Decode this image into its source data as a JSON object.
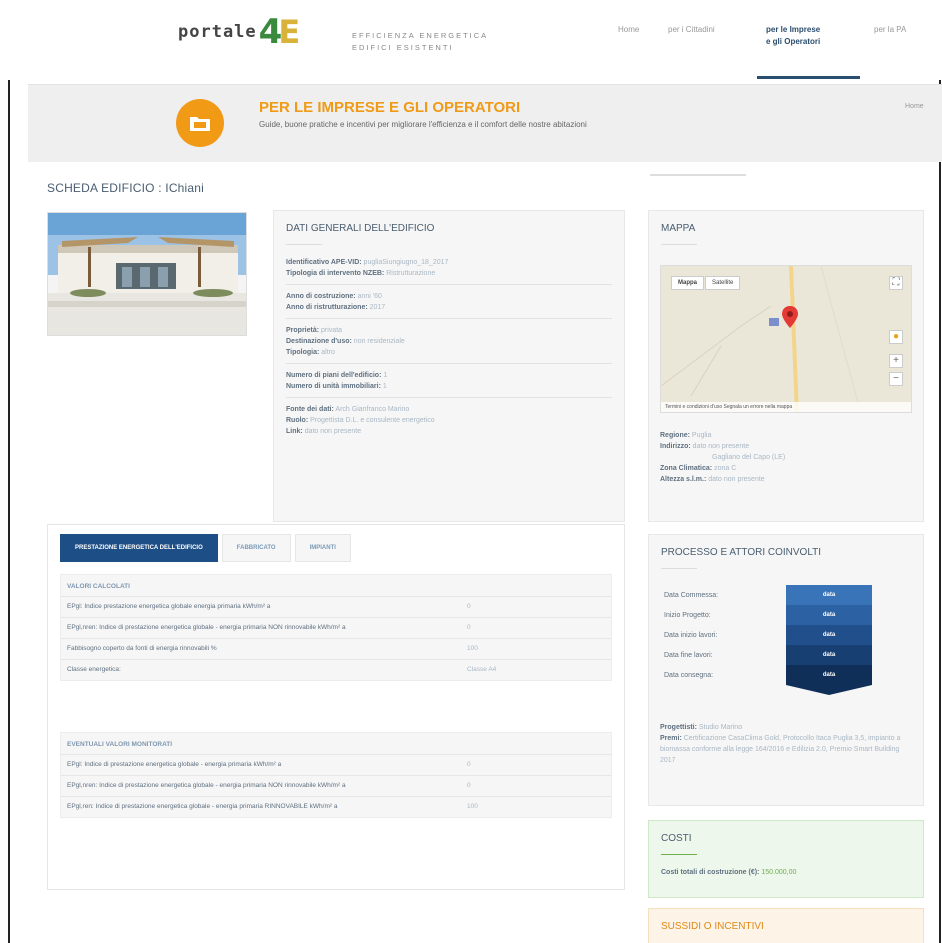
{
  "header": {
    "logo_word": "portale",
    "logo_number": "4",
    "logo_letter": "E",
    "tagline_line1": "EFFICIENZA ENERGETICA",
    "tagline_line2": "EDIFICI ESISTENTI",
    "nav": [
      {
        "label": "Home"
      },
      {
        "label": "per i Cittadini"
      },
      {
        "label_line1": "per le Imprese",
        "label_line2": "e gli Operatori"
      },
      {
        "label": "per la PA"
      }
    ]
  },
  "banner": {
    "title": "PER LE IMPRESE E GLI OPERATORI",
    "subtitle": "Guide, buone pratiche e incentivi per migliorare l'efficienza e il comfort delle nostre abitazioni",
    "right_text": "Home",
    "icon": "folder-icon",
    "accent_color": "#f09a16"
  },
  "page_title": "SCHEDA EDIFICIO : IChiani",
  "general": {
    "title": "DATI GENERALI DELL'EDIFICIO",
    "groups": [
      [
        {
          "label": "Identificativo APE-VID:",
          "value": "pugliaSiungiugno_18_2017"
        },
        {
          "label": "Tipologia di intervento NZEB:",
          "value": "Ristrutturazione"
        }
      ],
      [
        {
          "label": "Anno di costruzione:",
          "value": "anni '60"
        },
        {
          "label": "Anno di ristrutturazione:",
          "value": "2017"
        }
      ],
      [
        {
          "label": "Proprietà:",
          "value": "privata"
        },
        {
          "label": "Destinazione d'uso:",
          "value": "non residenziale"
        },
        {
          "label": "Tipologia:",
          "value": "altro"
        }
      ],
      [
        {
          "label": "Numero di piani dell'edificio:",
          "value": "1"
        },
        {
          "label": "Numero di unità immobiliari:",
          "value": "1"
        }
      ],
      [
        {
          "label": "Fonte dei dati:",
          "value": "Arch Gianfranco Marino"
        },
        {
          "label": "Ruolo:",
          "value": "Progettista D.L. e consulente energetico"
        },
        {
          "label": "Link:",
          "value": "dato non presente"
        }
      ]
    ]
  },
  "map": {
    "title": "MAPPA",
    "map_btn": "Mappa",
    "sat_btn": "Satellite",
    "footer": "Termini e condizioni d'uso   Segnala un errore nella mappa",
    "details": [
      {
        "label": "Regione:",
        "value": "Puglia"
      },
      {
        "label": "Indirizzo:",
        "value": "dato non presente"
      },
      {
        "label": "",
        "value": "Gagliano del Capo (LE)"
      },
      {
        "label": "Zona Climatica:",
        "value": "zona C"
      },
      {
        "label": "Altezza s.l.m.:",
        "value": "dato non presente"
      }
    ]
  },
  "tabs": [
    {
      "label": "PRESTAZIONE ENERGETICA DELL'EDIFICIO",
      "active": true
    },
    {
      "label": "FABBRICATO",
      "active": false
    },
    {
      "label": "IMPIANTI",
      "active": false
    }
  ],
  "calc": {
    "title": "VALORI CALCOLATI",
    "rows": [
      {
        "label": "EPgl: Indice prestazione energetica globale energia primaria kWh/m² a",
        "value": "0"
      },
      {
        "label": "EPgl,nren: Indice di prestazione energetica globale - energia primaria NON rinnovabile kWh/m² a",
        "value": "0"
      },
      {
        "label": "Fabbisogno coperto da fonti di energia rinnovabili %",
        "value": "100"
      },
      {
        "label": "Classe energetica:",
        "value": "Classe A4"
      }
    ]
  },
  "monitored": {
    "title": "EVENTUALI VALORI MONITORATI",
    "rows": [
      {
        "label": "EPgl: Indice di prestazione energetica globale - energia primaria kWh/m² a",
        "value": "0"
      },
      {
        "label": "EPgl,nren: Indice di prestazione energetica globale - energia primaria NON rinnovabile kWh/m² a",
        "value": "0"
      },
      {
        "label": "EPgl,ren: Indice di prestazione energetica globale - energia primaria RINNOVABILE kWh/m² a",
        "value": "100"
      }
    ]
  },
  "process": {
    "title": "PROCESSO E ATTORI COINVOLTI",
    "rows": [
      {
        "label": "Data Commessa:",
        "value": "data"
      },
      {
        "label": "Inizio Progetto:",
        "value": "data"
      },
      {
        "label": "Data inizio lavori:",
        "value": "data"
      },
      {
        "label": "Data fine lavori:",
        "value": "data"
      },
      {
        "label": "Data consegna:",
        "value": "data"
      }
    ],
    "colors": [
      "#3a74b8",
      "#2c62a3",
      "#214f8b",
      "#173f72",
      "#0f2f58"
    ],
    "progettisti_label": "Progettisti:",
    "progettisti_value": "Studio Marino",
    "premi_label": "Premi:",
    "premi_value": "Certificazione CasaClima Gold, Protocollo Itaca Puglia 3,5, impianto a biomassa conforme alla legge 164/2016 e Edilizia 2.0, Premio Smart Building 2017"
  },
  "costs": {
    "title": "COSTI",
    "label": "Costi totali di costruzione (€):",
    "value": "150.000,00"
  },
  "incentives": {
    "title": "SUSSIDI O INCENTIVI"
  }
}
